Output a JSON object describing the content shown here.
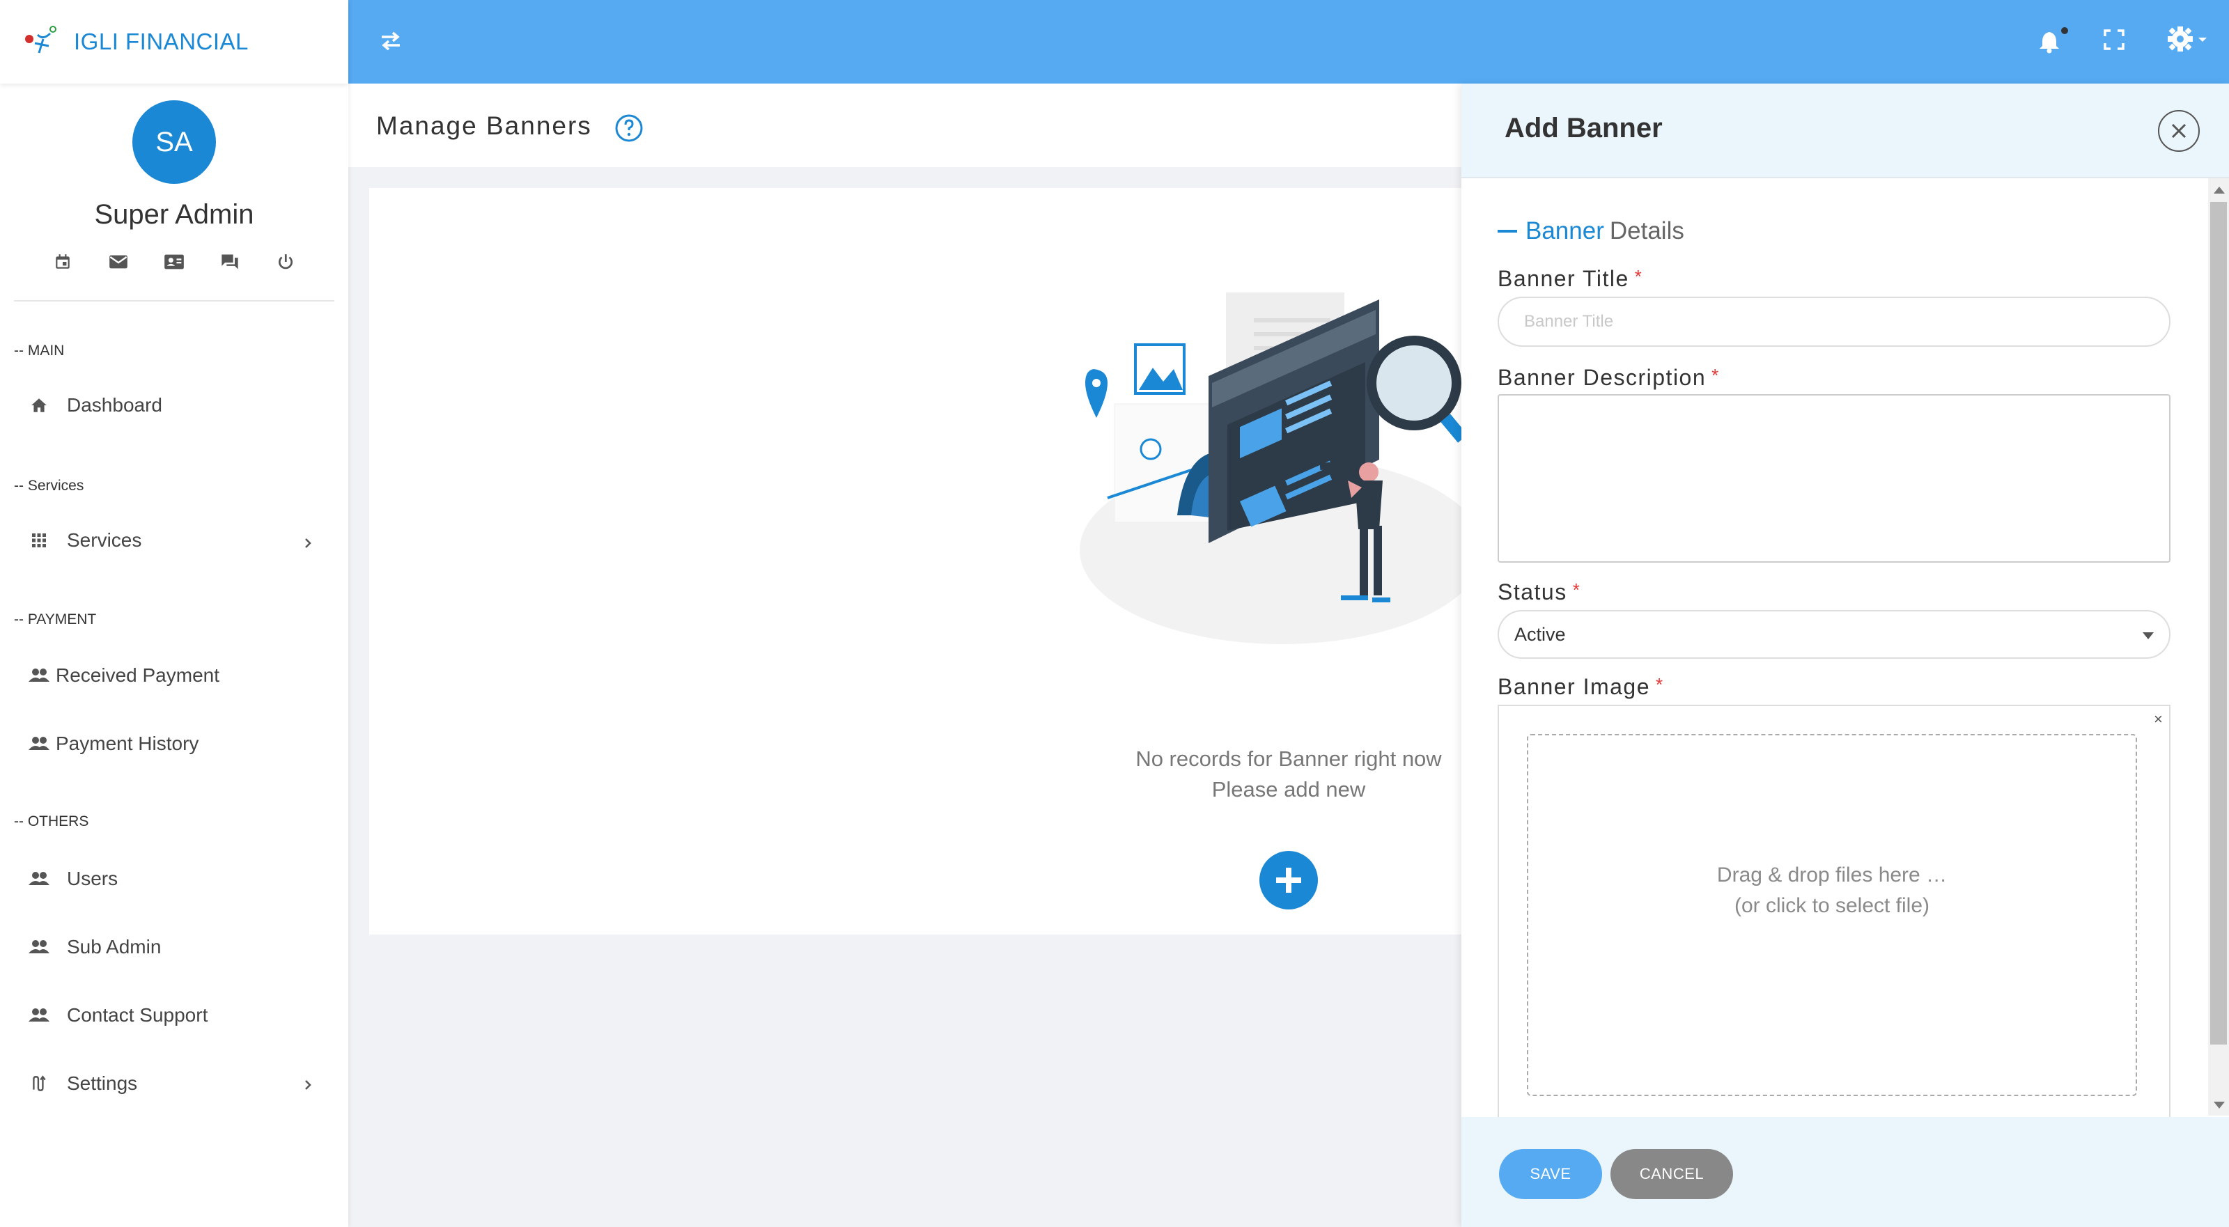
{
  "brand": {
    "name": "IGLI FINANCIAL"
  },
  "profile": {
    "initials": "SA",
    "name": "Super Admin",
    "icons": [
      "calendar-icon",
      "mail-icon",
      "contact-card-icon",
      "chat-icon",
      "power-icon"
    ]
  },
  "sidebar": {
    "sections": [
      {
        "label": "-- MAIN"
      },
      {
        "label": "-- Services"
      },
      {
        "label": "-- PAYMENT"
      },
      {
        "label": "-- OTHERS"
      }
    ],
    "items": [
      {
        "label": "Dashboard",
        "icon": "home-icon"
      },
      {
        "label": "Services",
        "icon": "apps-grid-icon",
        "has_submenu": true
      },
      {
        "label": "Received Payment",
        "icon": "people-icon"
      },
      {
        "label": "Payment History",
        "icon": "people-icon"
      },
      {
        "label": "Users",
        "icon": "people-icon"
      },
      {
        "label": "Sub Admin",
        "icon": "people-icon"
      },
      {
        "label": "Contact Support",
        "icon": "people-icon"
      },
      {
        "label": "Settings",
        "icon": "settings-route-icon",
        "has_submenu": true
      }
    ]
  },
  "topbar": {
    "color": "#56aaf2",
    "icons": [
      "swap-arrows-icon",
      "bell-icon",
      "fullscreen-icon",
      "gear-icon"
    ]
  },
  "page": {
    "title": "Manage Banners",
    "empty_line1": "No records for Banner right now",
    "empty_line2": "Please add new"
  },
  "drawer": {
    "title": "Add Banner",
    "section_blue": "Banner",
    "section_grey": "Details",
    "fields": {
      "title_label": "Banner Title",
      "title_placeholder": "Banner Title",
      "description_label": "Banner Description",
      "status_label": "Status",
      "status_value": "Active",
      "image_label": "Banner Image",
      "required_mark": "*",
      "file_clear": "×",
      "drop_line1": "Drag & drop files here …",
      "drop_line2": "(or click to select file)"
    },
    "save_label": "SAVE",
    "cancel_label": "CANCEL"
  },
  "colors": {
    "accent": "#1a88d4",
    "topbar": "#56aaf2",
    "required": "#e53935"
  }
}
